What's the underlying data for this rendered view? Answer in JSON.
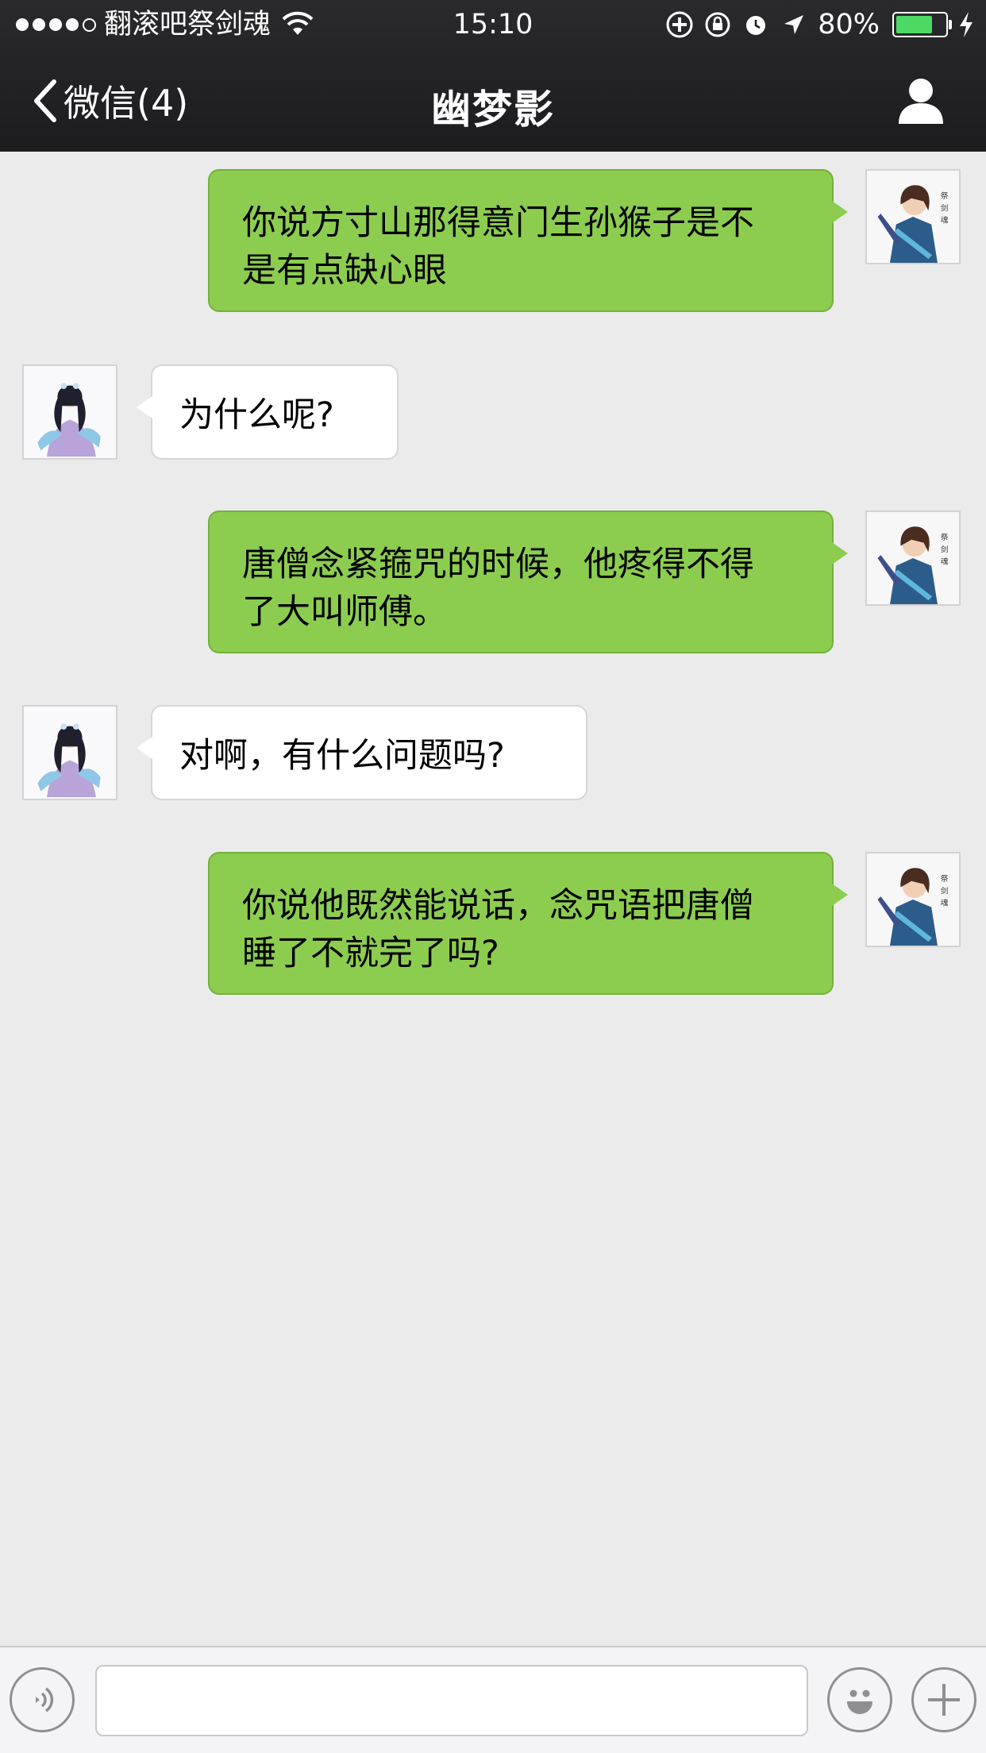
{
  "status_bar": {
    "carrier": "翻滚吧祭剑魂",
    "time": "15:10",
    "battery_text": "80%",
    "battery_level": 0.8,
    "signal_bars_filled": 4,
    "signal_bars_total": 5,
    "battery_color": "#4cd964"
  },
  "nav": {
    "back_label": "微信(4)",
    "title": "幽梦影",
    "profile_icon": "person-icon"
  },
  "messages": [
    {
      "direction": "out",
      "text": "你说方寸山那得意门生孙猴子是不\n是有点缺心眼",
      "avatar": "male-warrior-avatar"
    },
    {
      "direction": "in",
      "text": "为什么呢?",
      "avatar": "female-avatar"
    },
    {
      "direction": "out",
      "text": "唐僧念紧箍咒的时候，他疼得不得\n了大叫师傅。",
      "avatar": "male-warrior-avatar"
    },
    {
      "direction": "in",
      "text": "对啊，有什么问题吗?",
      "avatar": "female-avatar"
    },
    {
      "direction": "out",
      "text": "你说他既然能说话，念咒语把唐僧\n睡了不就完了吗?",
      "avatar": "male-warrior-avatar"
    }
  ],
  "input_bar": {
    "text_value": "",
    "voice_icon": "voice-icon",
    "emoji_icon": "emoji-icon",
    "plus_icon": "plus-icon"
  },
  "colors": {
    "outgoing_bubble": "#8ccd50",
    "incoming_bubble": "#ffffff",
    "chat_background": "#ebebeb",
    "nav_background": "#1c1c1e"
  }
}
